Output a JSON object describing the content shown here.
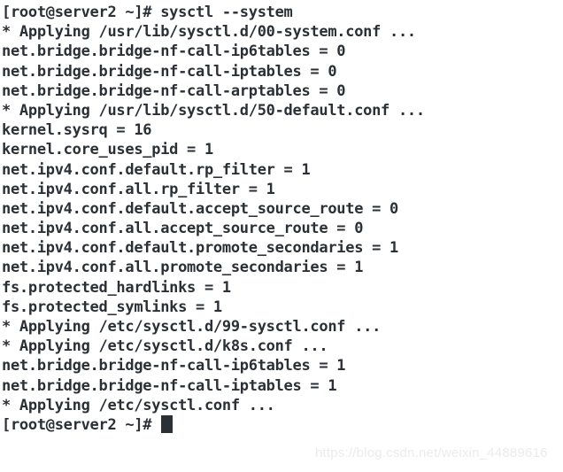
{
  "terminal": {
    "prompt": "[root@server2 ~]#",
    "command": "sysctl --system",
    "text_color": "#2b3036",
    "background_color": "#ffffff",
    "cursor": {
      "shape": "block",
      "color": "#2b3036",
      "visible": true
    },
    "lines": [
      "[root@server2 ~]# sysctl --system",
      "* Applying /usr/lib/sysctl.d/00-system.conf ...",
      "net.bridge.bridge-nf-call-ip6tables = 0",
      "net.bridge.bridge-nf-call-iptables = 0",
      "net.bridge.bridge-nf-call-arptables = 0",
      "* Applying /usr/lib/sysctl.d/50-default.conf ...",
      "kernel.sysrq = 16",
      "kernel.core_uses_pid = 1",
      "net.ipv4.conf.default.rp_filter = 1",
      "net.ipv4.conf.all.rp_filter = 1",
      "net.ipv4.conf.default.accept_source_route = 0",
      "net.ipv4.conf.all.accept_source_route = 0",
      "net.ipv4.conf.default.promote_secondaries = 1",
      "net.ipv4.conf.all.promote_secondaries = 1",
      "fs.protected_hardlinks = 1",
      "fs.protected_symlinks = 1",
      "* Applying /etc/sysctl.d/99-sysctl.conf ...",
      "* Applying /etc/sysctl.d/k8s.conf ...",
      "net.bridge.bridge-nf-call-ip6tables = 1",
      "net.bridge.bridge-nf-call-iptables = 1",
      "* Applying /etc/sysctl.conf ..."
    ],
    "final_prompt": "[root@server2 ~]# "
  },
  "watermark": {
    "text": "https://blog.csdn.net/weixin_44889616",
    "color": "#e9ebee"
  }
}
